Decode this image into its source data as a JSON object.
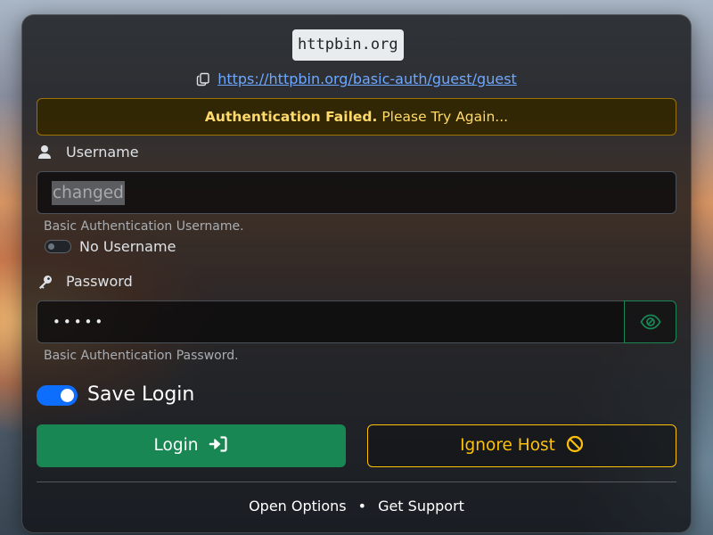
{
  "host": "httpbin.org",
  "url": "https://httpbin.org/basic-auth/guest/guest",
  "alert": {
    "strong": "Authentication Failed.",
    "text": " Please Try Again..."
  },
  "username": {
    "label": "Username",
    "value": "changed",
    "help": "Basic Authentication Username.",
    "no_username_label": "No Username",
    "no_username_checked": false
  },
  "password": {
    "label": "Password",
    "masked_value": "•••••",
    "help": "Basic Authentication Password."
  },
  "save_login": {
    "label": "Save Login",
    "checked": true
  },
  "buttons": {
    "login": "Login",
    "ignore_host": "Ignore Host"
  },
  "footer": {
    "open_options": "Open Options",
    "separator": "•",
    "get_support": "Get Support"
  },
  "icons": {
    "copy": "copy-icon",
    "user": "person-icon",
    "key": "key-icon",
    "eye": "eye-icon",
    "login": "login-arrow-icon",
    "ignore": "ban-icon"
  },
  "colors": {
    "accent_green": "#198754",
    "warning": "#ffc107",
    "primary": "#0d6efd",
    "link": "#6ea8fe"
  }
}
